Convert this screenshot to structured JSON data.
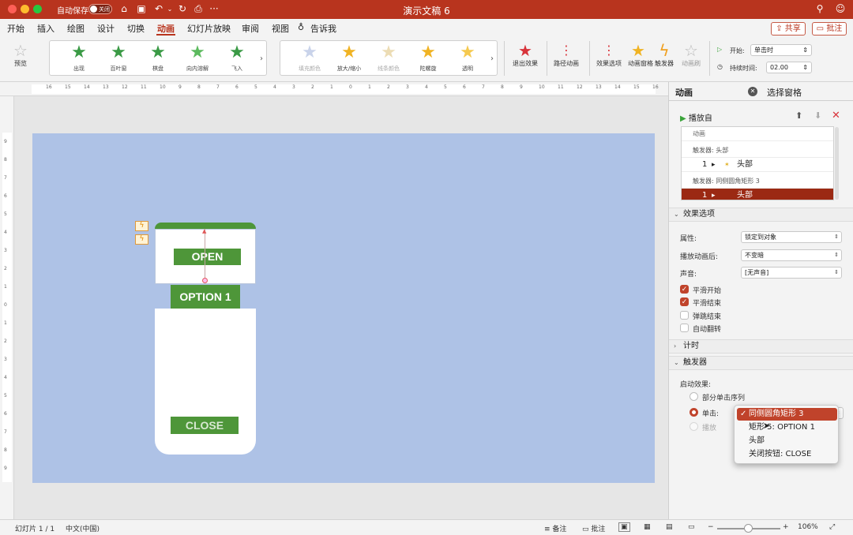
{
  "titlebar": {
    "autosave_label": "自动保存",
    "autosave_state": "关闭",
    "doc_title": "演示文稿 6",
    "home_icon": "home-icon",
    "save_icon": "save-icon",
    "undo_icon": "undo-icon",
    "redo_icon": "redo-icon",
    "print_icon": "print-icon",
    "more_icon": "more-icon"
  },
  "menu": {
    "tabs": [
      "开始",
      "插入",
      "绘图",
      "设计",
      "切换",
      "动画",
      "幻灯片放映",
      "审阅",
      "视图",
      "告诉我"
    ],
    "share": "共享",
    "comment": "批注"
  },
  "ribbon": {
    "preview": "预览",
    "entrance_effects": [
      "出现",
      "百叶窗",
      "棋盘",
      "向内溶解",
      "飞入"
    ],
    "emphasis_effects": [
      "填充颜色",
      "放大/缩小",
      "线条颜色",
      "陀螺旋",
      "透明"
    ],
    "exit_effects": "退出效果",
    "path_animation": "路径动画",
    "effect_options": "效果选项",
    "animation_pane": "动画窗格",
    "trigger": "触发器",
    "animate_background": "动画刷",
    "start_label": "开始:",
    "start_value": "单击时",
    "duration_label": "持续时间:",
    "duration_value": "02.00"
  },
  "ruler": {
    "h_numbers": [
      "16",
      "15",
      "14",
      "13",
      "12",
      "11",
      "10",
      "9",
      "8",
      "7",
      "6",
      "5",
      "4",
      "3",
      "2",
      "1",
      "0",
      "1",
      "2",
      "3",
      "4",
      "5",
      "6",
      "7",
      "8",
      "9",
      "10",
      "11",
      "12",
      "13",
      "14",
      "15",
      "16"
    ],
    "v_numbers": [
      "9",
      "8",
      "7",
      "6",
      "5",
      "4",
      "3",
      "2",
      "1",
      "0",
      "1",
      "2",
      "3",
      "4",
      "5",
      "6",
      "7",
      "8",
      "9"
    ]
  },
  "slide": {
    "open_label": "OPEN",
    "option_label": "OPTION 1",
    "close_label": "CLOSE"
  },
  "panel": {
    "tab_animation": "动画",
    "tab_selection": "选择窗格",
    "play_from": "播放自",
    "list": {
      "header": "动画",
      "trigger1": "触发器: 头部",
      "item1_num": "1",
      "item1_label": "头部",
      "trigger2": "触发器: 同侧圆角矩形 3",
      "item2_num": "1",
      "item2_label": "头部"
    },
    "effect_options": {
      "title": "效果选项",
      "property_label": "属性:",
      "property_value": "锁定到对象",
      "after_label": "播放动画后:",
      "after_value": "不变暗",
      "sound_label": "声音:",
      "sound_value": "[无声音]",
      "smooth_start": "平滑开始",
      "smooth_end": "平滑结束",
      "bounce_end": "弹跳结束",
      "auto_reverse": "自动翻转"
    },
    "timing": "计时",
    "trigger": {
      "title": "触发器",
      "start_effect": "启动效果:",
      "sequence": "部分单击序列",
      "click": "单击:",
      "play": "播放"
    }
  },
  "dropdown": {
    "options": [
      "同侧圆角矩形 3",
      "矩形 5: OPTION 1",
      "头部",
      "关闭按钮: CLOSE"
    ],
    "selected": 0
  },
  "statusbar": {
    "slide": "幻灯片 1 / 1",
    "language": "中文(中国)",
    "notes": "备注",
    "comments": "批注",
    "zoom": "106%"
  },
  "colors": {
    "titlebar": "#b8341e",
    "slide_bg": "#aec2e6",
    "button_green": "#4e9639",
    "accent": "#c0432b"
  }
}
